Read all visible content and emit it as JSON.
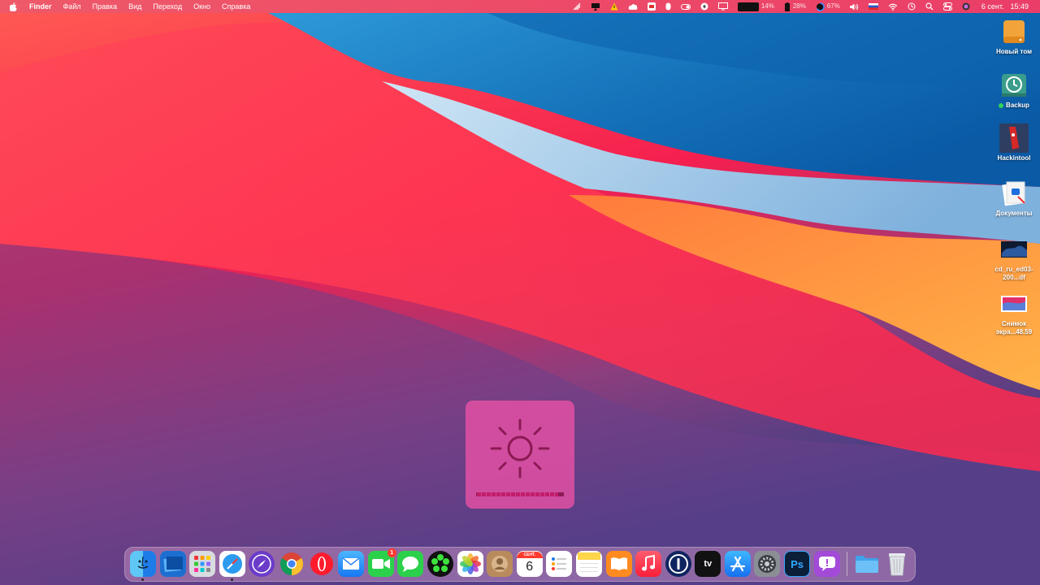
{
  "menubar": {
    "app_name": "Finder",
    "menus": [
      "Файл",
      "Правка",
      "Вид",
      "Переход",
      "Окно",
      "Справка"
    ],
    "status": {
      "cpu_percent": "14%",
      "battery_percent": "28%",
      "other_percent": "67%",
      "date": "6 сент.",
      "time": "15:49"
    },
    "status_icons": [
      "airdrop-icon",
      "airplay-icon",
      "warning-icon",
      "icloud-icon",
      "app-icon",
      "mouse-icon",
      "toggle-icon",
      "vpn-icon",
      "display-icon",
      "cpu-meter",
      "battery-meter",
      "progress-ring-icon",
      "volume-icon",
      "flag-ru-icon",
      "wifi-icon",
      "time-machine-icon",
      "spotlight-icon",
      "control-center-icon",
      "siri-icon"
    ]
  },
  "desktop": {
    "icons": [
      {
        "label": "Новый том",
        "icon": "drive-icon"
      },
      {
        "label": "Backup",
        "icon": "time-machine-drive-icon",
        "status_color": "#2fd25a"
      },
      {
        "label": "Hackintool",
        "icon": "hackintool-icon"
      },
      {
        "label": "Документы",
        "icon": "documents-icon"
      },
      {
        "label": "cd_ru_ed03-200...df",
        "icon": "pdf-file-icon"
      },
      {
        "label": "Снимок экра...48.59",
        "icon": "screenshot-file-icon"
      }
    ]
  },
  "hud": {
    "type": "brightness",
    "level": 0.94,
    "icon": "sun-icon"
  },
  "dock": {
    "apps": [
      {
        "name": "Finder",
        "icon": "finder-icon",
        "running": true
      },
      {
        "name": "Files",
        "icon": "files-icon"
      },
      {
        "name": "Launchpad",
        "icon": "launchpad-icon"
      },
      {
        "name": "Safari",
        "icon": "safari-icon",
        "running": true
      },
      {
        "name": "Compass",
        "icon": "compass-icon"
      },
      {
        "name": "Chrome",
        "icon": "chrome-icon"
      },
      {
        "name": "Opera",
        "icon": "opera-icon"
      },
      {
        "name": "Mail",
        "icon": "mail-icon"
      },
      {
        "name": "FaceTime",
        "icon": "facetime-icon",
        "badge": "1"
      },
      {
        "name": "Messages",
        "icon": "messages-icon"
      },
      {
        "name": "ICQ",
        "icon": "icq-icon"
      },
      {
        "name": "Photos",
        "icon": "photos-icon"
      },
      {
        "name": "Contacts",
        "icon": "contacts-icon"
      },
      {
        "name": "Calendar",
        "icon": "calendar-icon",
        "month": "СЕНТ.",
        "day": "6"
      },
      {
        "name": "Reminders",
        "icon": "reminders-icon"
      },
      {
        "name": "Notes",
        "icon": "notes-icon"
      },
      {
        "name": "Books",
        "icon": "books-icon"
      },
      {
        "name": "Music",
        "icon": "music-icon"
      },
      {
        "name": "1Password",
        "icon": "onepassword-icon"
      },
      {
        "name": "TV",
        "icon": "apple-tv-icon",
        "text": "tv"
      },
      {
        "name": "App Store",
        "icon": "app-store-icon"
      },
      {
        "name": "System Preferences",
        "icon": "system-preferences-icon"
      },
      {
        "name": "Photoshop",
        "icon": "photoshop-icon",
        "text": "Ps"
      },
      {
        "name": "Feedback",
        "icon": "feedback-icon"
      }
    ],
    "stack": [
      {
        "name": "Downloads",
        "icon": "folder-icon"
      },
      {
        "name": "Trash",
        "icon": "trash-icon"
      }
    ]
  },
  "colors": {
    "hud_bg": "#e650a5",
    "hud_fg": "#8c1a54",
    "menubar_text": "#ffffff"
  }
}
